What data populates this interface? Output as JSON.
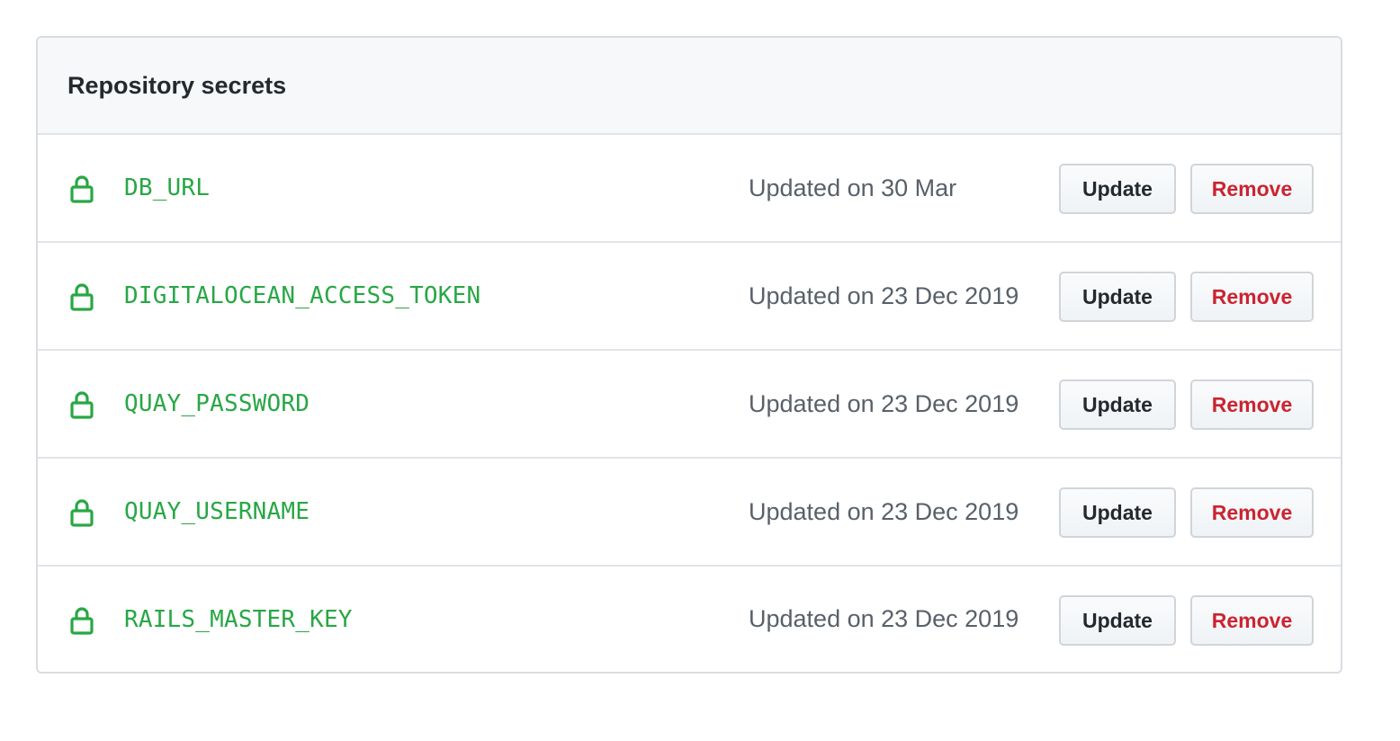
{
  "panel": {
    "title": "Repository secrets"
  },
  "colors": {
    "secret_name": "#28a745",
    "remove_text": "#cb2431",
    "muted_text": "#586069"
  },
  "secrets": [
    {
      "name": "DB_URL",
      "updated": "Updated on 30 Mar",
      "update_label": "Update",
      "remove_label": "Remove",
      "icon": "lock-icon"
    },
    {
      "name": "DIGITALOCEAN_ACCESS_TOKEN",
      "updated": "Updated on 23 Dec 2019",
      "update_label": "Update",
      "remove_label": "Remove",
      "icon": "lock-icon"
    },
    {
      "name": "QUAY_PASSWORD",
      "updated": "Updated on 23 Dec 2019",
      "update_label": "Update",
      "remove_label": "Remove",
      "icon": "lock-icon"
    },
    {
      "name": "QUAY_USERNAME",
      "updated": "Updated on 23 Dec 2019",
      "update_label": "Update",
      "remove_label": "Remove",
      "icon": "lock-icon"
    },
    {
      "name": "RAILS_MASTER_KEY",
      "updated": "Updated on 23 Dec 2019",
      "update_label": "Update",
      "remove_label": "Remove",
      "icon": "lock-icon"
    }
  ]
}
